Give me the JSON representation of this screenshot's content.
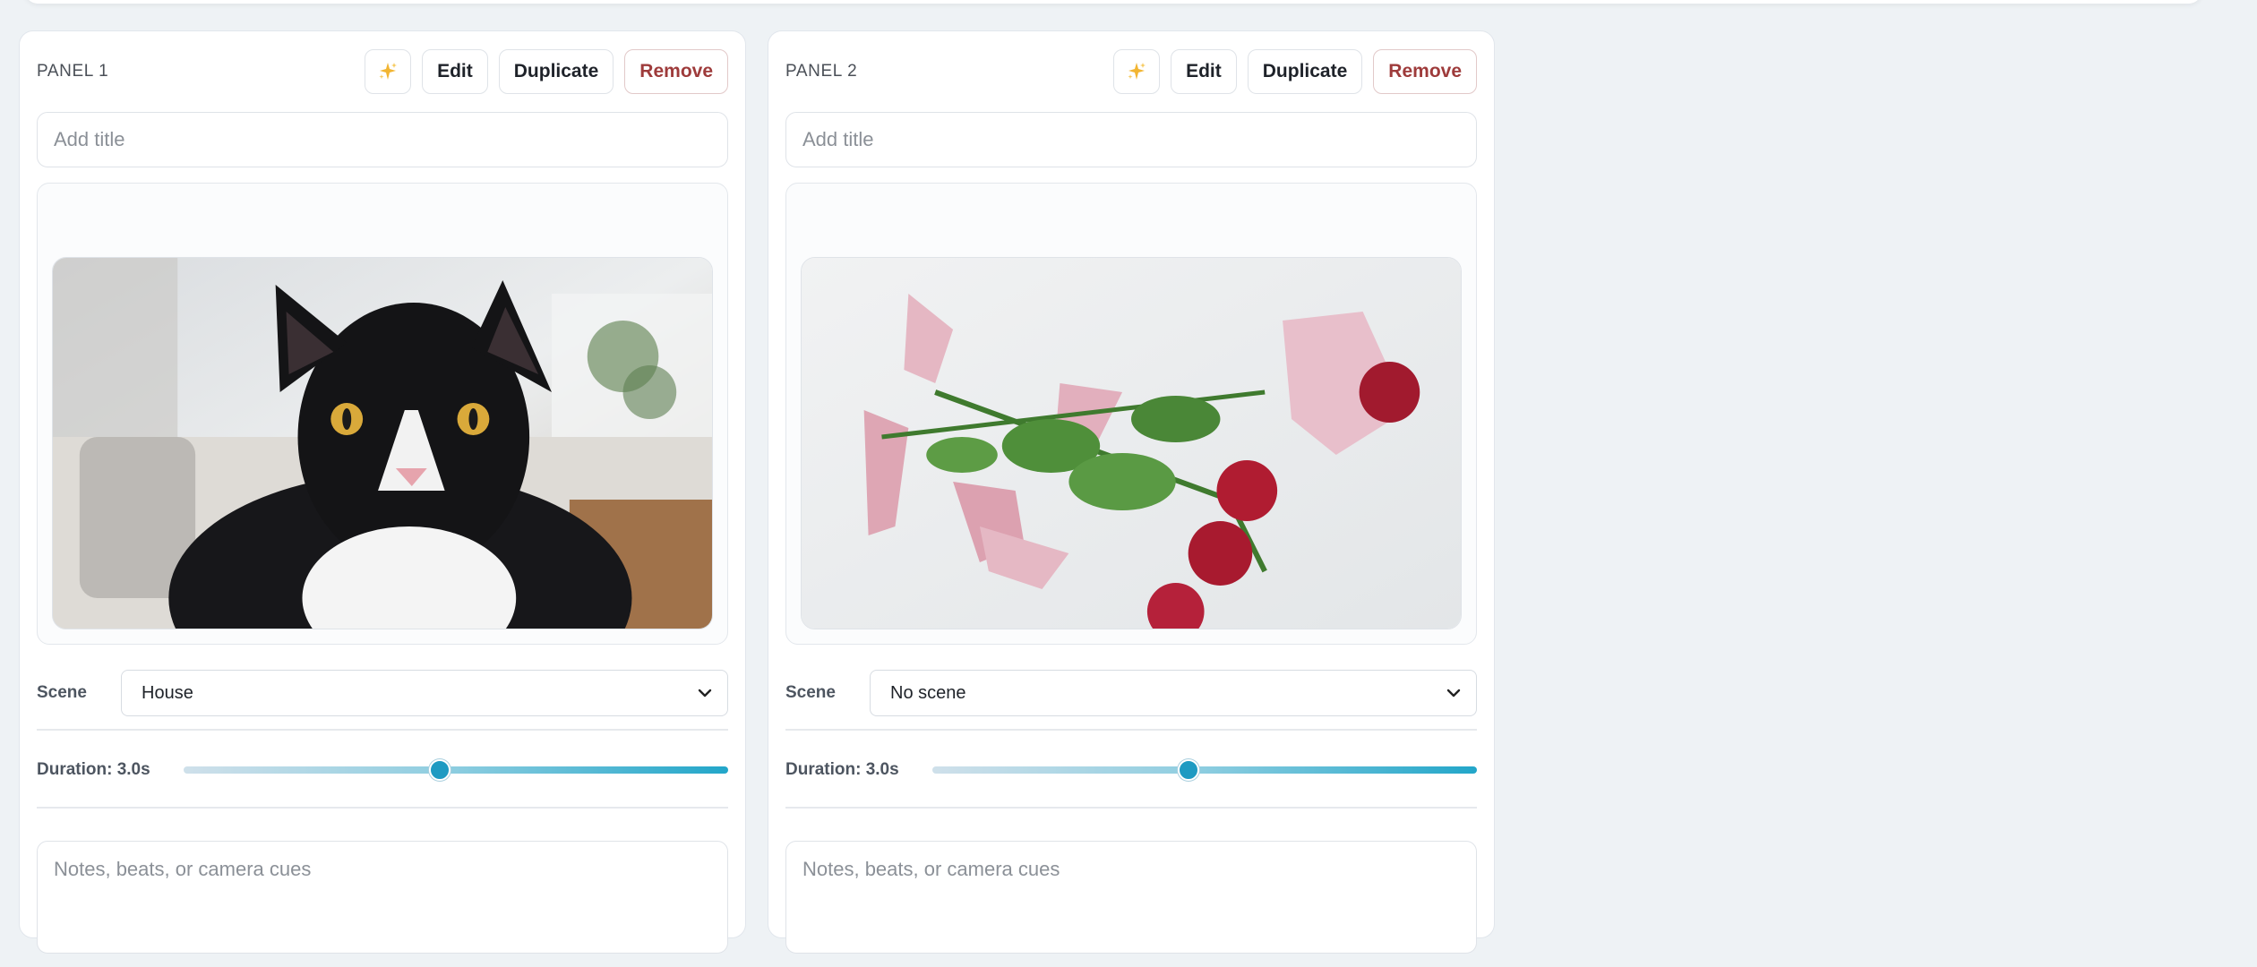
{
  "panels": [
    {
      "label": "PANEL 1",
      "actions": {
        "ai_icon": "sparkles-icon",
        "edit_label": "Edit",
        "duplicate_label": "Duplicate",
        "remove_label": "Remove"
      },
      "title": {
        "value": "",
        "placeholder": "Add title"
      },
      "image_subject": "black-and-white cat",
      "scene": {
        "label": "Scene",
        "selected": "House"
      },
      "duration": {
        "label": "Duration: 3.0s",
        "fraction": 0.47
      },
      "notes": {
        "value": "",
        "placeholder": "Notes, beats, or camera cues"
      }
    },
    {
      "label": "PANEL 2",
      "actions": {
        "ai_icon": "sparkles-icon",
        "edit_label": "Edit",
        "duplicate_label": "Duplicate",
        "remove_label": "Remove"
      },
      "title": {
        "value": "",
        "placeholder": "Add title"
      },
      "image_subject": "broken pink vase with red roses",
      "scene": {
        "label": "Scene",
        "selected": "No scene"
      },
      "duration": {
        "label": "Duration: 3.0s",
        "fraction": 0.47
      },
      "notes": {
        "value": "",
        "placeholder": "Notes, beats, or camera cues"
      }
    }
  ],
  "colors": {
    "remove_text": "#9e3b3b",
    "slider_accent": "#1e9ac2",
    "sparkle": "#f2b532"
  }
}
